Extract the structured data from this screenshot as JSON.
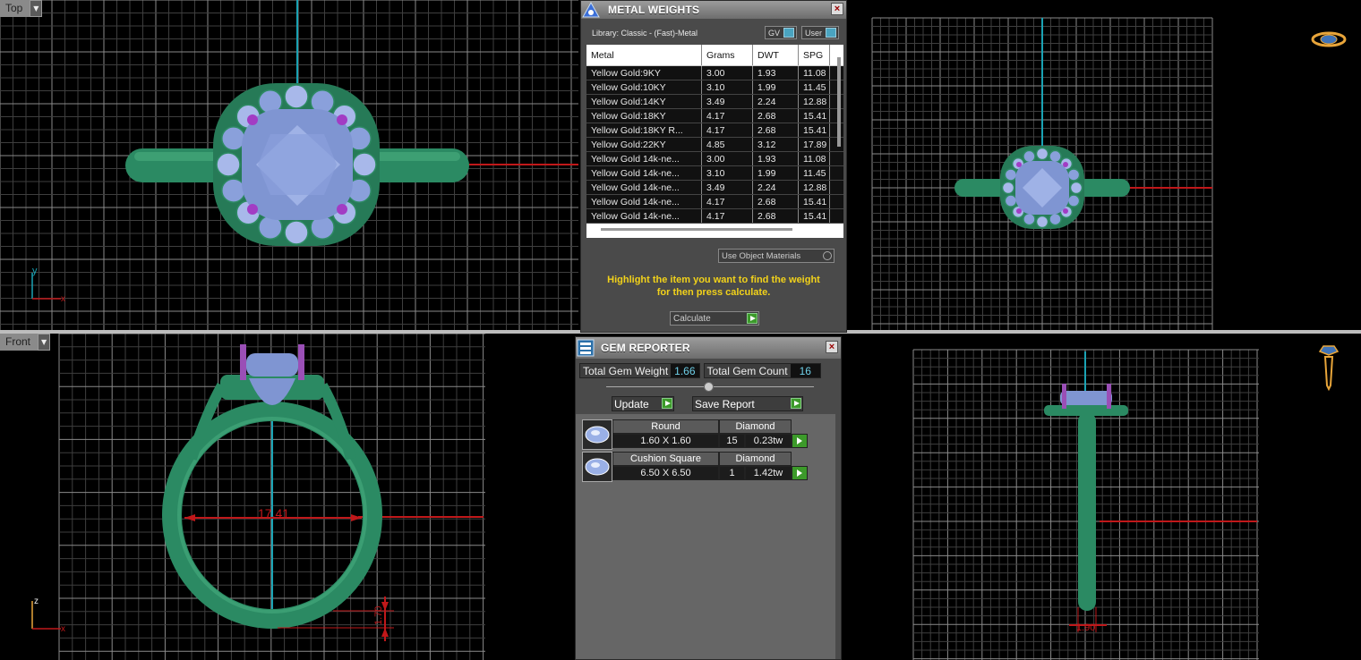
{
  "viewports": {
    "top_left": {
      "label": "Top",
      "axis_y": "y",
      "axis_x": "x"
    },
    "bottom_left": {
      "label": "Front",
      "axis_z": "z",
      "axis_x": "x",
      "dim_width": "17.41",
      "dim_height": "1.70"
    },
    "bottom_right": {
      "dim_width": "1.90"
    }
  },
  "metal_weights": {
    "title": "METAL WEIGHTS",
    "library": "Library: Classic - (Fast)-Metal",
    "gv_label": "GV",
    "user_label": "User",
    "columns": [
      "Metal",
      "Grams",
      "DWT",
      "SPG"
    ],
    "rows": [
      [
        "Yellow Gold:9KY",
        "3.00",
        "1.93",
        "11.08"
      ],
      [
        "Yellow Gold:10KY",
        "3.10",
        "1.99",
        "11.45"
      ],
      [
        "Yellow Gold:14KY",
        "3.49",
        "2.24",
        "12.88"
      ],
      [
        "Yellow Gold:18KY",
        "4.17",
        "2.68",
        "15.41"
      ],
      [
        "Yellow Gold:18KY R...",
        "4.17",
        "2.68",
        "15.41"
      ],
      [
        "Yellow Gold:22KY",
        "4.85",
        "3.12",
        "17.89"
      ],
      [
        "Yellow Gold 14k-ne...",
        "3.00",
        "1.93",
        "11.08"
      ],
      [
        "Yellow Gold 14k-ne...",
        "3.10",
        "1.99",
        "11.45"
      ],
      [
        "Yellow Gold 14k-ne...",
        "3.49",
        "2.24",
        "12.88"
      ],
      [
        "Yellow Gold 14k-ne...",
        "4.17",
        "2.68",
        "15.41"
      ],
      [
        "Yellow Gold 14k-ne...",
        "4.17",
        "2.68",
        "15.41"
      ]
    ],
    "use_object_materials": "Use Object Materials",
    "hint_line1": "Highlight the item you want to find the weight",
    "hint_line2": "for then press calculate.",
    "calculate": "Calculate"
  },
  "gem_reporter": {
    "title": "GEM REPORTER",
    "total_weight_label": "Total Gem Weight",
    "total_weight": "1.66",
    "total_count_label": "Total Gem Count",
    "total_count": "16",
    "update": "Update",
    "save_report": "Save Report",
    "gems": [
      {
        "shape": "Round",
        "type": "Diamond",
        "size": "1.60 X 1.60",
        "count": "15",
        "ctw": "0.23tw"
      },
      {
        "shape": "Cushion Square",
        "type": "Diamond",
        "size": "6.50 X 6.50",
        "count": "1",
        "ctw": "1.42tw"
      }
    ]
  },
  "colors": {
    "metal": "#2e8a64",
    "gem": "#8a9ed8",
    "prong": "#9a4fb6",
    "axis_blue": "#1aa3b4",
    "axis_red": "#c0181a",
    "hint": "#f2d21a"
  }
}
